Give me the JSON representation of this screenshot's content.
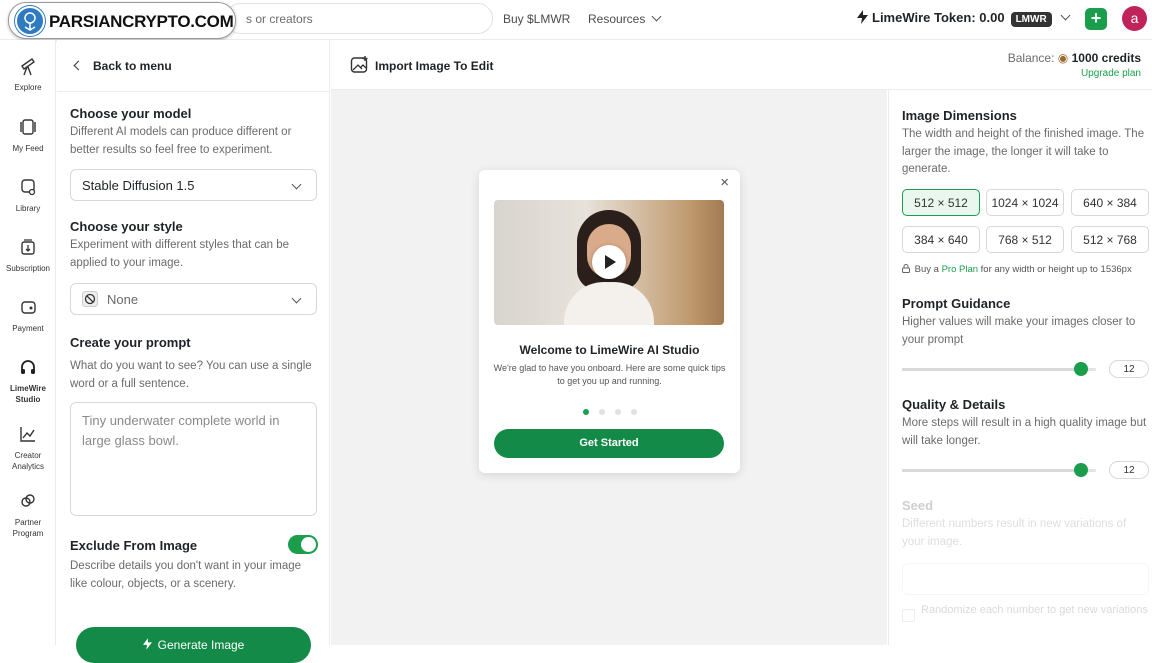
{
  "topbar": {
    "search_placeholder": "s or creators",
    "buy_link": "Buy $LMWR",
    "resources_link": "Resources",
    "token_label": "LimeWire Token: 0.00",
    "token_badge": "LMWR",
    "plus_label": "+",
    "avatar_letter": "a"
  },
  "watermark": {
    "text": "PARSIANCRYPTO.COM"
  },
  "leftnav": {
    "items": [
      {
        "label": "Explore",
        "icon": "telescope-icon"
      },
      {
        "label": "My Feed",
        "icon": "feed-icon"
      },
      {
        "label": "Library",
        "icon": "library-icon"
      },
      {
        "label": "Subscription",
        "icon": "subscription-icon"
      },
      {
        "label": "Payment",
        "icon": "wallet-icon"
      },
      {
        "label": "LimeWire Studio",
        "icon": "headphones-icon"
      },
      {
        "label": "Creator Analytics",
        "icon": "analytics-icon"
      },
      {
        "label": "Partner Program",
        "icon": "partner-icon"
      }
    ]
  },
  "settings": {
    "back_label": "Back to menu",
    "model_title": "Choose your model",
    "model_desc": "Different AI models can produce different or better results so feel free to experiment.",
    "model_value": "Stable Diffusion 1.5",
    "style_title": "Choose your style",
    "style_desc": "Experiment with different styles that can be applied to your image.",
    "style_value": "None",
    "prompt_title": "Create your prompt",
    "prompt_desc": "What do you want to see? You can use a single word or a full sentence.",
    "prompt_placeholder": "Tiny underwater complete world in large glass bowl.",
    "exclude_title": "Exclude From Image",
    "exclude_desc": "Describe details you don't want in your image like colour, objects, or a scenery.",
    "exclude_enabled": true,
    "generate_label": "Generate Image"
  },
  "main": {
    "import_label": "Import Image To Edit",
    "balance_label": "Balance:",
    "balance_value": "1000 credits",
    "upgrade_label": "Upgrade plan"
  },
  "modal": {
    "close_label": "×",
    "title": "Welcome to LimeWire AI Studio",
    "desc": "We're glad to have you onboard. Here are some quick tips to get you up and running.",
    "dots_total": 4,
    "dots_active": 1,
    "cta_label": "Get Started"
  },
  "right": {
    "dims_title": "Image Dimensions",
    "dims_desc": "The width and height of the finished image. The larger the image, the longer it will take to generate.",
    "dims": [
      "512 × 512",
      "1024 × 1024",
      "640 × 384",
      "384 × 640",
      "768 × 512",
      "512 × 768"
    ],
    "dims_selected": "512 × 512",
    "pro_prefix": "Buy a",
    "pro_link": "Pro Plan",
    "pro_suffix": "for any width or height up to 1536px",
    "guidance_title": "Prompt Guidance",
    "guidance_desc": "Higher values will make your images closer to your prompt",
    "guidance_value": "12",
    "quality_title": "Quality & Details",
    "quality_desc": "More steps will result in a high quality image but will take longer.",
    "quality_value": "12",
    "seed_title": "Seed",
    "seed_desc": "Different numbers result in new variations of your image.",
    "randomize_label": "Randomize each number to get new variations"
  },
  "colors": {
    "accent": "#1a9e4c",
    "button": "#138a47",
    "avatar": "#c0225a"
  }
}
